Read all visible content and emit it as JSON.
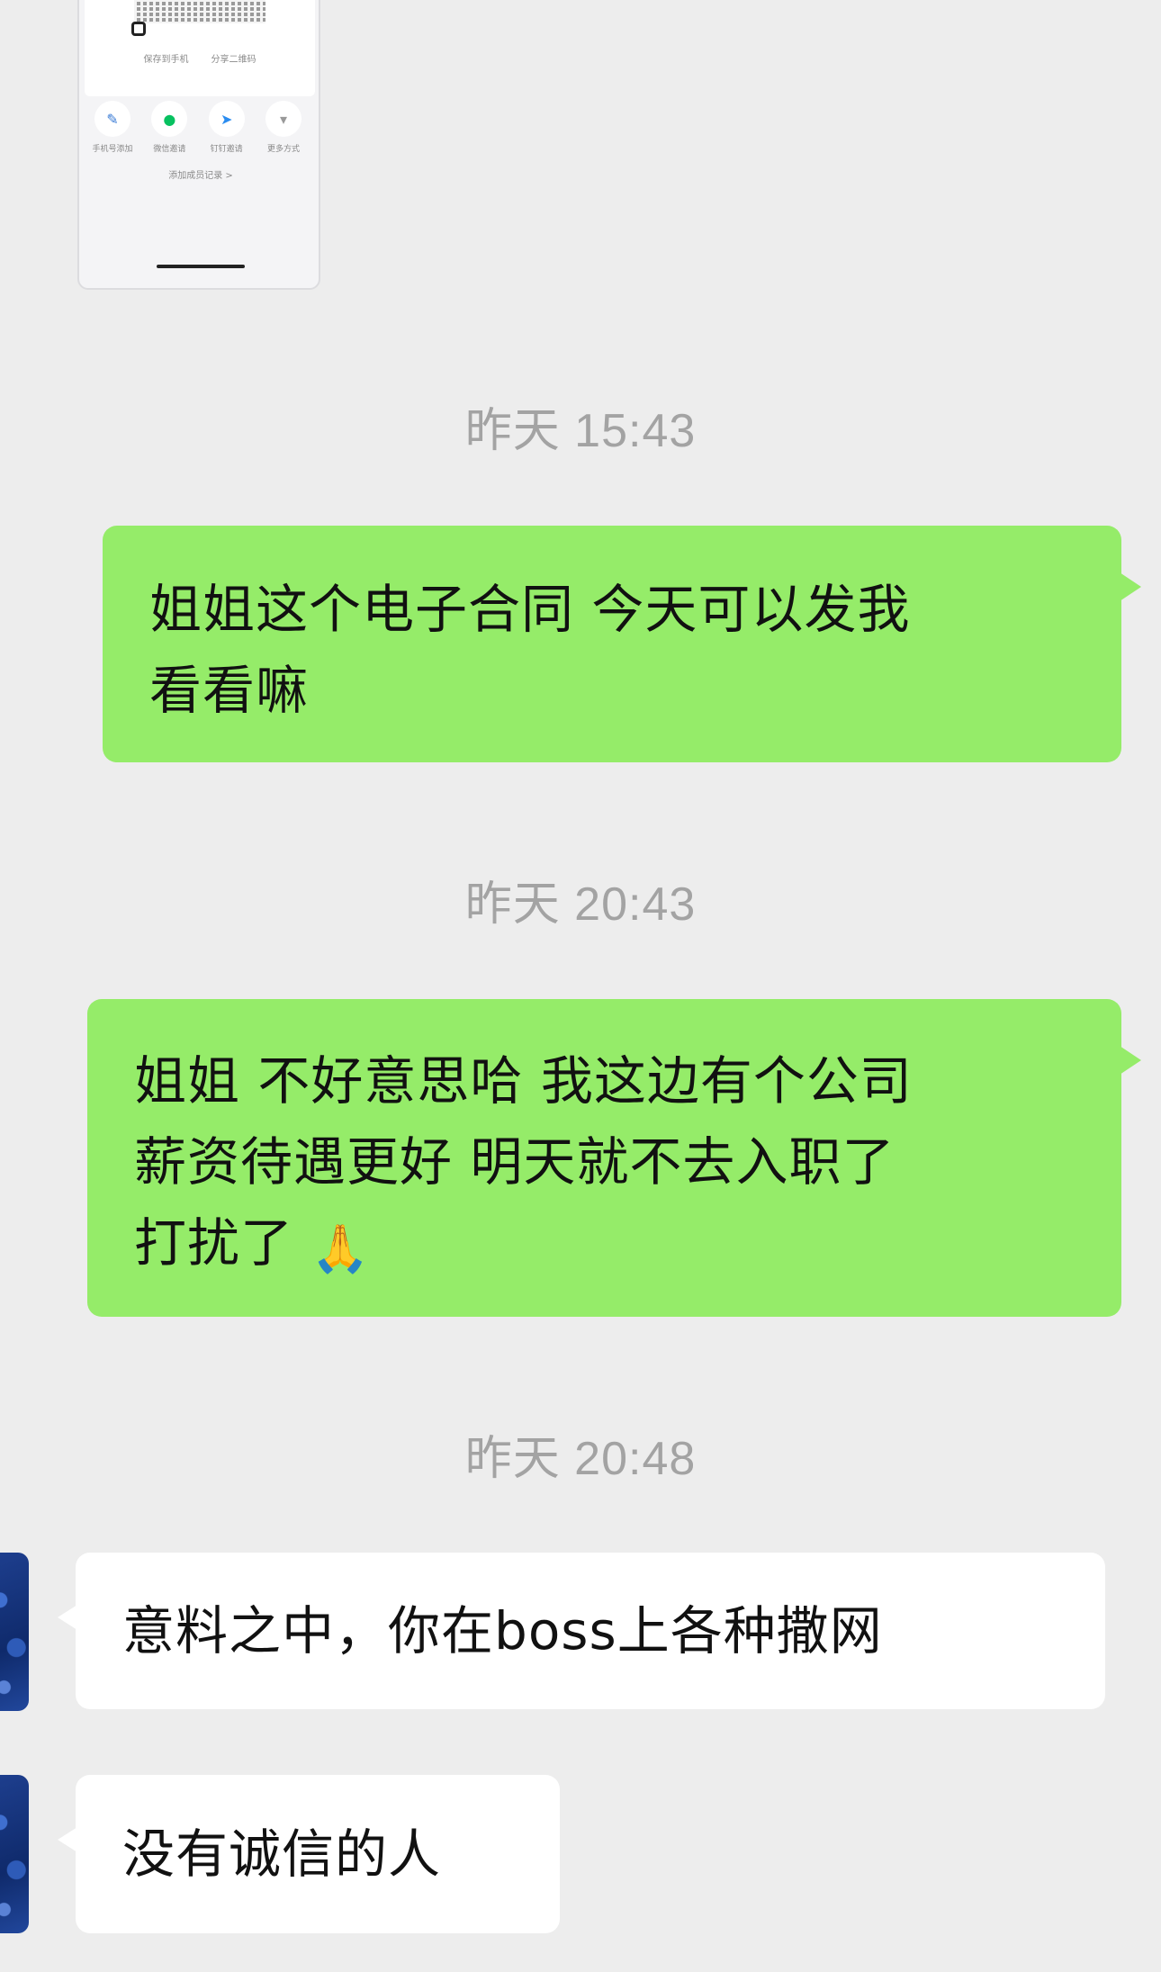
{
  "screenshot_card": {
    "links": [
      "保存到手机",
      "分享二维码"
    ],
    "actions": [
      {
        "icon": "pencil-icon",
        "glyph": "✎",
        "color": "#3a7bd5",
        "label": "手机号添加"
      },
      {
        "icon": "wechat-icon",
        "glyph": "●",
        "color": "#07c160",
        "label": "微信邀请"
      },
      {
        "icon": "dingtalk-icon",
        "glyph": "➤",
        "color": "#2a8cf0",
        "label": "钉钉邀请"
      },
      {
        "icon": "chevron-down-icon",
        "glyph": "▾",
        "color": "#999999",
        "label": "更多方式"
      }
    ],
    "record_link": "添加成员记录 >"
  },
  "messages": [
    {
      "type": "time",
      "text": "昨天 15:43"
    },
    {
      "type": "sent",
      "lines": [
        "姐姐这个电子合同 今天可以发我",
        "看看嘛"
      ]
    },
    {
      "type": "time",
      "text": "昨天 20:43"
    },
    {
      "type": "sent",
      "lines": [
        "姐姐 不好意思哈 我这边有个公司",
        "薪资待遇更好 明天就不去入职了",
        "打扰了"
      ],
      "emoji": "🙏"
    },
    {
      "type": "time",
      "text": "昨天 20:48"
    },
    {
      "type": "received",
      "lines": [
        "意料之中，你在boss上各种撒网"
      ]
    },
    {
      "type": "received",
      "lines": [
        "没有诚信的人"
      ]
    }
  ],
  "colors": {
    "background": "#ededed",
    "sent_bubble": "#95ec69",
    "received_bubble": "#ffffff",
    "timestamp_text": "#a3a3a3"
  }
}
